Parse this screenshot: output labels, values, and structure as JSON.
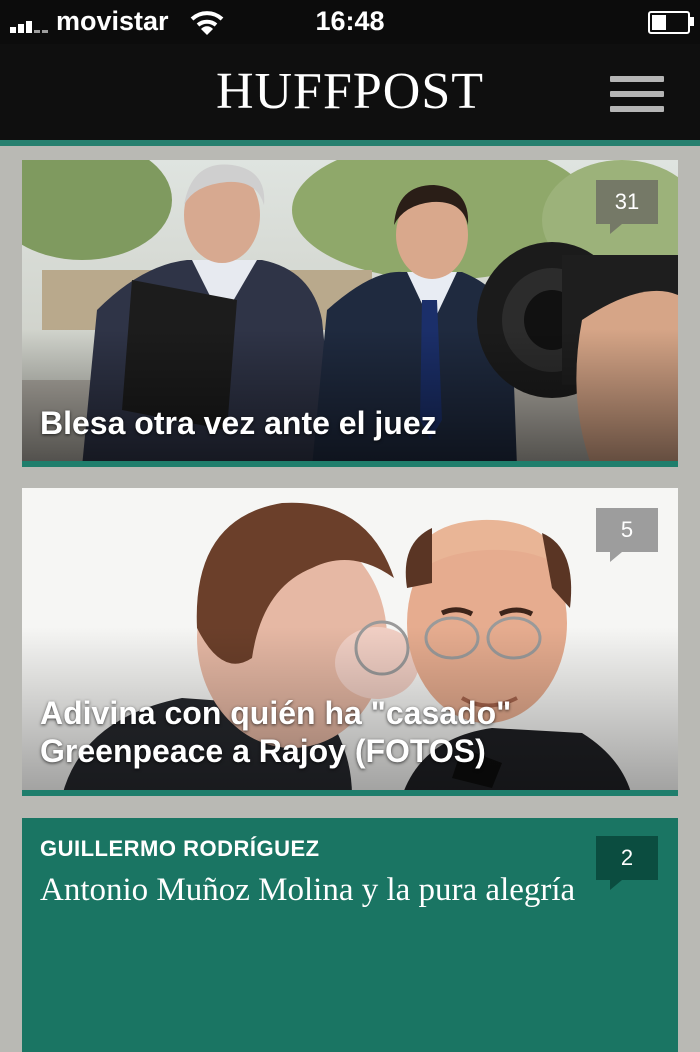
{
  "status_bar": {
    "carrier": "movistar",
    "time": "16:48"
  },
  "navbar": {
    "logo": "HUFFPOST"
  },
  "colors": {
    "brand_green": "#1f7e6c",
    "opinion_card": "#1a7563",
    "comment_bubble_dark": "#0b4d40"
  },
  "icons": [
    "signal-icon",
    "wifi-icon",
    "battery-icon",
    "menu-icon",
    "comment-bubble-icon"
  ],
  "articles": [
    {
      "title": "Blesa otra vez ante el juez",
      "comments": "31"
    },
    {
      "title": "Adivina con quién ha \"casado\" Greenpeace a Rajoy (FOTOS)",
      "comments": "5"
    }
  ],
  "opinion": {
    "author": "GUILLERMO RODRÍGUEZ",
    "title": "Antonio Muñoz Molina y la pura alegría",
    "comments": "2"
  }
}
